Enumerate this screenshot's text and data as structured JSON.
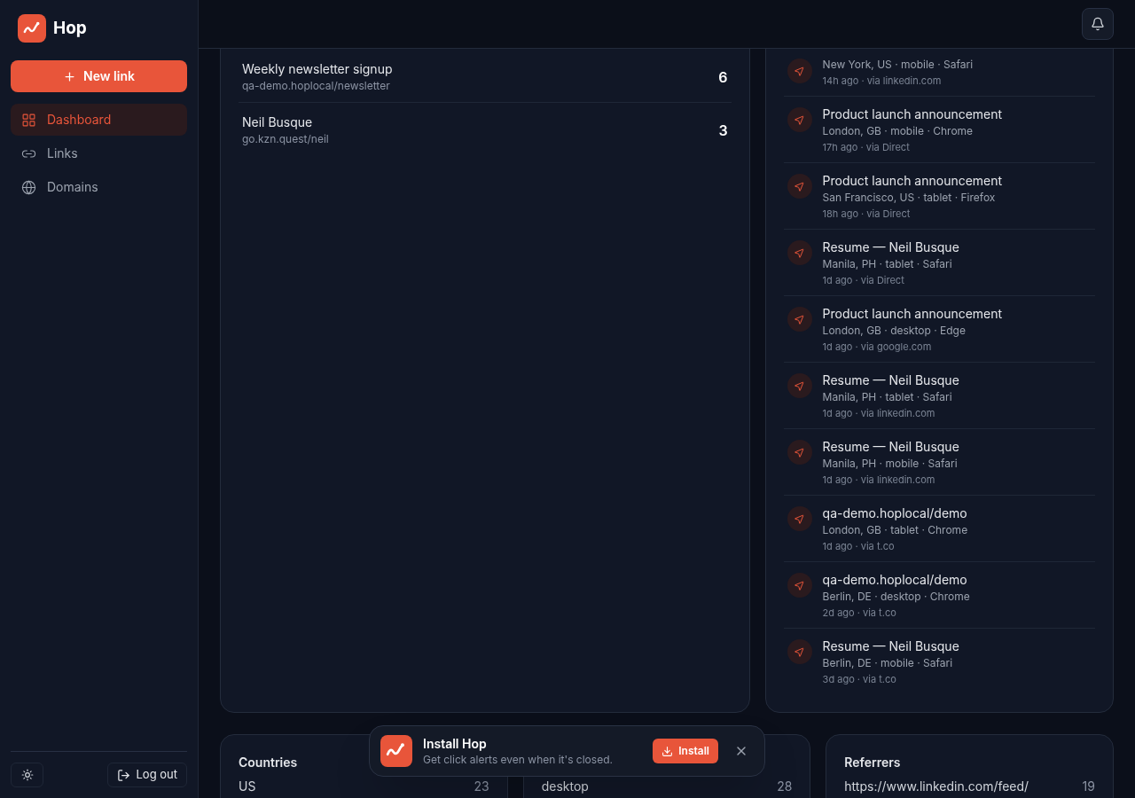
{
  "brand": {
    "name": "Hop"
  },
  "sidebar": {
    "new_link": "New link",
    "items": [
      {
        "label": "Dashboard",
        "kind": "dashboard",
        "selected": true
      },
      {
        "label": "Links",
        "kind": "links",
        "selected": false
      },
      {
        "label": "Domains",
        "kind": "domains",
        "selected": false
      }
    ],
    "logout": "Log out"
  },
  "top_links": [
    {
      "title": "Weekly newsletter signup",
      "url": "qa-demo.hoplocal/newsletter",
      "count": "6"
    },
    {
      "title": "Neil Busque",
      "url": "go.kzn.quest/neil",
      "count": "3"
    }
  ],
  "recent_clicks": [
    {
      "meta": "New York, US · mobile · Safari",
      "when": "14h ago · via linkedin.com"
    },
    {
      "title": "Product launch announcement",
      "meta": "London, GB · mobile · Chrome",
      "when": "17h ago · via Direct"
    },
    {
      "title": "Product launch announcement",
      "meta": "San Francisco, US · tablet · Firefox",
      "when": "18h ago · via Direct"
    },
    {
      "title": "Resume — Neil Busque",
      "meta": "Manila, PH · tablet · Safari",
      "when": "1d ago · via Direct"
    },
    {
      "title": "Product launch announcement",
      "meta": "London, GB · desktop · Edge",
      "when": "1d ago · via google.com"
    },
    {
      "title": "Resume — Neil Busque",
      "meta": "Manila, PH · tablet · Safari",
      "when": "1d ago · via linkedin.com"
    },
    {
      "title": "Resume — Neil Busque",
      "meta": "Manila, PH · mobile · Safari",
      "when": "1d ago · via linkedin.com"
    },
    {
      "title": "qa-demo.hoplocal/demo",
      "meta": "London, GB · tablet · Chrome",
      "when": "1d ago · via t.co"
    },
    {
      "title": "qa-demo.hoplocal/demo",
      "meta": "Berlin, DE · desktop · Chrome",
      "when": "2d ago · via t.co"
    },
    {
      "title": "Resume — Neil Busque",
      "meta": "Berlin, DE · mobile · Safari",
      "when": "3d ago · via t.co"
    }
  ],
  "breakdowns": [
    {
      "title": "Countries",
      "rows": [
        {
          "label": "US",
          "count": "23"
        }
      ]
    },
    {
      "rows": [
        {
          "label": "desktop",
          "count": "28"
        }
      ]
    },
    {
      "title": "Referrers",
      "rows": [
        {
          "label": "https://www.linkedin.com/feed/",
          "count": "19"
        }
      ]
    }
  ],
  "toast": {
    "title": "Install Hop",
    "body": "Get click alerts even when it's closed.",
    "action": "Install"
  }
}
